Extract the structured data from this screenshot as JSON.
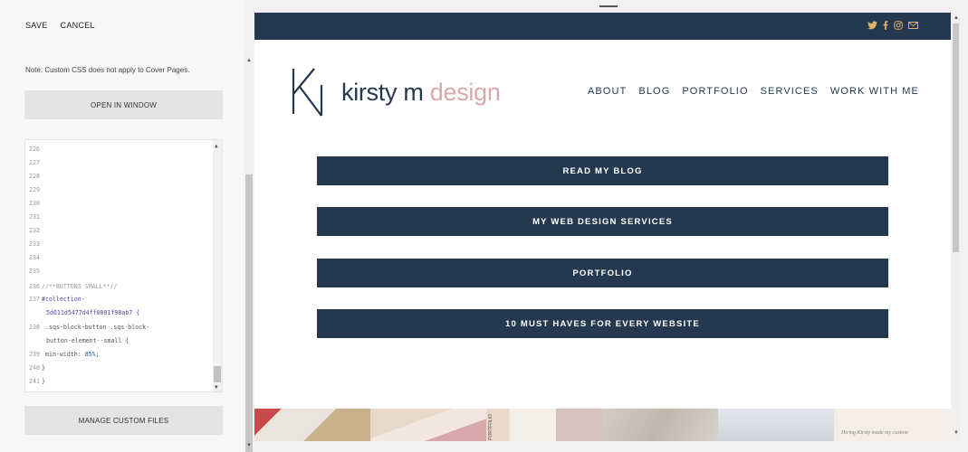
{
  "toolbar": {
    "save_label": "SAVE",
    "cancel_label": "CANCEL"
  },
  "editor": {
    "note": "Note: Custom CSS does not apply to Cover Pages.",
    "open_window_label": "OPEN IN WINDOW",
    "manage_files_label": "MANAGE CUSTOM FILES",
    "line_numbers": [
      "226",
      "227",
      "228",
      "229",
      "230",
      "231",
      "232",
      "233",
      "234",
      "235",
      "236",
      "237",
      "238",
      "239",
      "240",
      "241"
    ],
    "code": {
      "comment": "//**BUTTONS SMALL**//",
      "selector_1": "#collection-",
      "selector_2": "5d611d5477d4ff0001f98ab7 {",
      "selector_3": ".sqs-block-button .sqs-block-",
      "selector_4": "button-element--small {",
      "prop": "min-width:",
      "value": "85%;",
      "close_1": "}",
      "close_2": "}"
    }
  },
  "site": {
    "logo_text": "kirsty m ",
    "logo_accent": "design",
    "nav": [
      "ABOUT",
      "BLOG",
      "PORTFOLIO",
      "SERVICES",
      "WORK WITH ME"
    ],
    "social_icons": [
      "twitter-icon",
      "facebook-icon",
      "instagram-icon",
      "email-icon"
    ],
    "buttons": [
      "READ MY BLOG",
      "MY WEB DESIGN SERVICES",
      "PORTFOLIO",
      "10 MUST HAVES FOR EVERY WEBSITE"
    ],
    "strip_text": "Hiring Kirsty made my custom",
    "portfolio_tile_label": "PORTFOLIO"
  },
  "colors": {
    "navy": "#243850",
    "pink": "#d9a8ad",
    "gold": "#d9b36a"
  }
}
